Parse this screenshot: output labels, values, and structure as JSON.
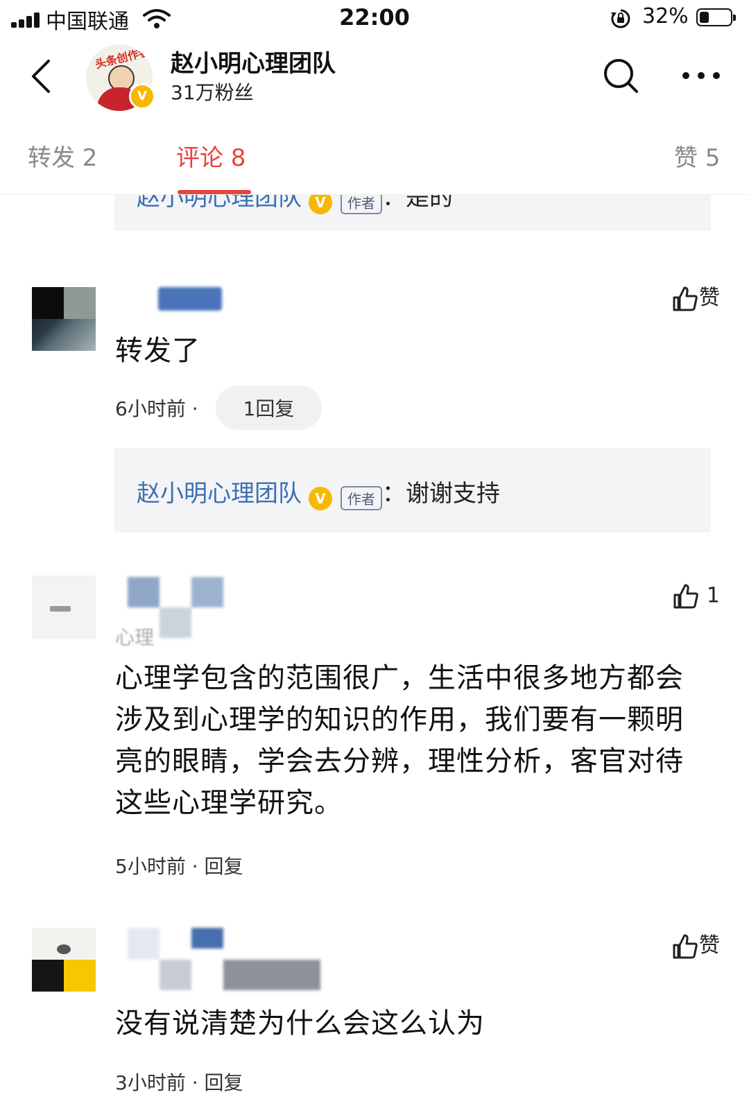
{
  "status_bar": {
    "carrier": "中国联通",
    "time": "22:00",
    "battery_percent": "32%",
    "battery_level": 0.32
  },
  "header": {
    "account_name": "赵小明心理团队",
    "followers": "31万粉丝",
    "avatar_badge_text": "头条创作者",
    "verified_mark": "V"
  },
  "tabs": {
    "repost": "转发 2",
    "comments": "评论 8",
    "likes": "赞 5"
  },
  "top_reply_partial": {
    "name": "赵小明心理团队",
    "author_tag": "作者",
    "text": "：是的"
  },
  "comments": [
    {
      "text": "转发了",
      "time": "6小时前",
      "separator": "·",
      "reply_count": "1回复",
      "like_label": "赞",
      "author_reply": {
        "name": "赵小明心理团队",
        "author_tag": "作者",
        "text": "：谢谢支持"
      }
    },
    {
      "name_partial": "心理",
      "text": "心理学包含的范围很广，生活中很多地方都会涉及到心理学的知识的作用，我们要有一颗明亮的眼睛，学会去分辨，理性分析，客官对待这些心理学研究。",
      "time": "5小时前",
      "separator": "·",
      "reply_label": "回复",
      "like_count": "1"
    },
    {
      "text": "没有说清楚为什么会这么认为",
      "time": "3小时前",
      "separator": "·",
      "reply_label": "回复",
      "like_label": "赞"
    }
  ],
  "colors": {
    "accent": "#e9433b",
    "link_blue": "#3b6fb4",
    "verified_gold": "#f6b800",
    "reply_bg": "#f4f4f6"
  },
  "icons": [
    "back-arrow-icon",
    "search-icon",
    "more-dots-icon",
    "thumbs-up-icon",
    "wifi-icon",
    "rotation-lock-icon",
    "battery-icon",
    "signal-icon"
  ]
}
